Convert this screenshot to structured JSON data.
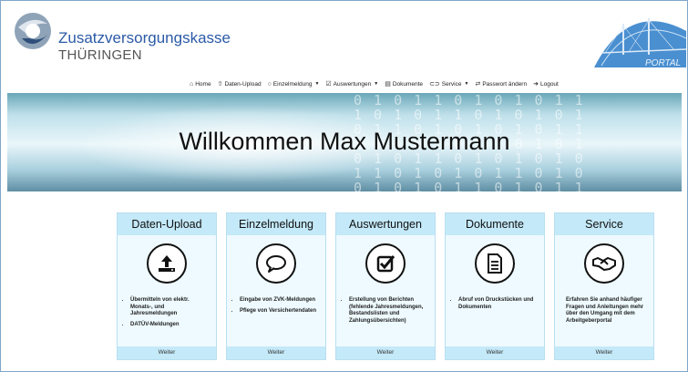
{
  "brand": {
    "name_line1": "Zusatzversorgungskasse",
    "name_line2": "THÜRINGEN",
    "portal_label": "PORTAL"
  },
  "nav": {
    "home": "Home",
    "daten_upload": "Daten-Upload",
    "einzelmeldung": "Einzelmeldung",
    "auswertungen": "Auswertungen",
    "dokumente": "Dokumente",
    "service": "Service",
    "passwort": "Passwort ändern",
    "logout": "Logout"
  },
  "banner": {
    "welcome": "Willkommen Max Mustermann",
    "binary_lines": [
      "0 1 0 1 1 0 1 0 1 0 1 1",
      "1 0 1 0 1 1 0 1 0 1 0 1",
      "0 1 1 0 1 0 1 0 1 0 1 1",
      "1 0 1 0 1 0 1 1 0 1 0 1",
      "0 1 0 1 1 0 1 0 1 0 1 0",
      "1 1 0 1 0 1 0 1 1 0 1 0",
      "0 1 0 1 0 1 1 0 1 0 1 1"
    ]
  },
  "cards": [
    {
      "title": "Daten-Upload",
      "icon": "upload-icon",
      "items": [
        "Übermitteln von elektr. Monats-, und Jahresmeldungen",
        "DATÜV-Meldungen"
      ],
      "footer": "Weiter"
    },
    {
      "title": "Einzelmeldung",
      "icon": "speech-bubble-icon",
      "items": [
        "Eingabe von ZVK-Meldungen",
        "Pflege von Versichertendaten"
      ],
      "footer": "Weiter"
    },
    {
      "title": "Auswertungen",
      "icon": "checkbox-icon",
      "items": [
        "Erstellung von Berichten (fehlende Jahresmeldungen, Bestandslisten und Zahlungsübersichten)"
      ],
      "footer": "Weiter"
    },
    {
      "title": "Dokumente",
      "icon": "document-icon",
      "items": [
        "Abruf von Druckstücken und Dokumenten"
      ],
      "footer": "Weiter"
    },
    {
      "title": "Service",
      "icon": "handshake-icon",
      "text": "Erfahren Sie anhand häufiger Fragen und Anleitungen mehr über den Umgang mit dem Arbeitgeberportal",
      "footer": "Weiter"
    }
  ]
}
